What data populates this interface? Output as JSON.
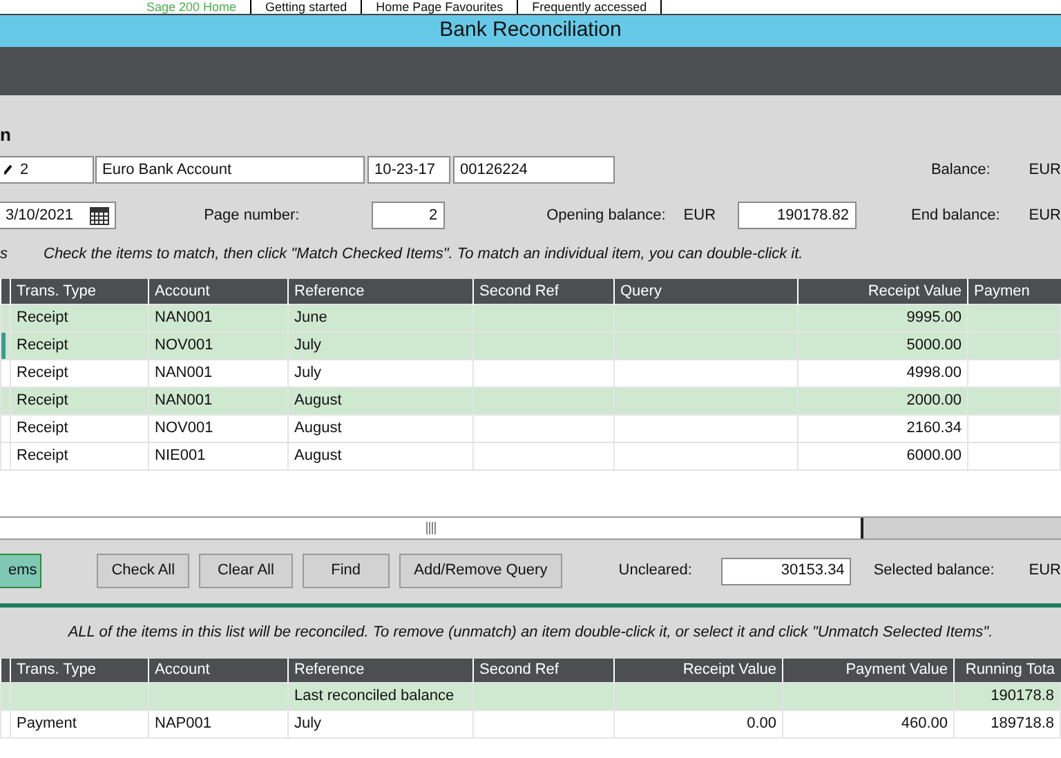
{
  "top_tabs": [
    {
      "label": "Sage 200 Home",
      "selected": true
    },
    {
      "label": "Getting started",
      "selected": false
    },
    {
      "label": "Home Page Favourites",
      "selected": false
    },
    {
      "label": "Frequently accessed",
      "selected": false
    }
  ],
  "window": {
    "title": "Bank Reconciliation"
  },
  "section_heading": "n",
  "bank": {
    "code": "2",
    "name": "Euro Bank Account",
    "sort_code": "10-23-17",
    "account_number": "00126224",
    "balance_label": "Balance:",
    "balance_currency": "EUR"
  },
  "statement": {
    "date": "3/10/2021",
    "page_label": "Page number:",
    "page": "2",
    "opening_label": "Opening balance:",
    "opening_currency": "EUR",
    "opening_balance": "190178.82",
    "end_label": "End balance:",
    "end_currency": "EUR"
  },
  "instruction_label": "s",
  "instruction": "Check the items to match, then click \"Match Checked Items\". To match an individual item, you can double-click it.",
  "unmatched": {
    "columns": [
      {
        "label": "Trans. Type",
        "numeric": false
      },
      {
        "label": "Account",
        "numeric": false
      },
      {
        "label": "Reference",
        "numeric": false
      },
      {
        "label": "Second Ref",
        "numeric": false
      },
      {
        "label": "Query",
        "numeric": false
      },
      {
        "label": "Receipt Value",
        "numeric": true
      },
      {
        "label": "Paymen",
        "numeric": false
      }
    ],
    "rows": [
      {
        "cells": [
          "Receipt",
          "NAN001",
          "June",
          null,
          null,
          "9995.00",
          null
        ],
        "checked": true,
        "current": false
      },
      {
        "cells": [
          "Receipt",
          "NOV001",
          "July",
          null,
          null,
          "5000.00",
          null
        ],
        "checked": true,
        "current": true
      },
      {
        "cells": [
          "Receipt",
          "NAN001",
          "July",
          null,
          null,
          "4998.00",
          null
        ],
        "checked": false,
        "current": false
      },
      {
        "cells": [
          "Receipt",
          "NAN001",
          "August",
          null,
          null,
          "2000.00",
          null
        ],
        "checked": true,
        "current": false
      },
      {
        "cells": [
          "Receipt",
          "NOV001",
          "August",
          null,
          null,
          "2160.34",
          null
        ],
        "checked": false,
        "current": false
      },
      {
        "cells": [
          "Receipt",
          "NIE001",
          "August",
          null,
          null,
          "6000.00",
          null
        ],
        "checked": false,
        "current": false
      }
    ]
  },
  "buttons": [
    {
      "label": "ems",
      "kind": "primary"
    },
    {
      "label": "Check All",
      "kind": "secondary"
    },
    {
      "label": "Clear All",
      "kind": "secondary"
    },
    {
      "label": "Find",
      "kind": "secondary"
    },
    {
      "label": "Add/Remove Query",
      "kind": "secondary"
    }
  ],
  "uncleared_label": "Uncleared:",
  "uncleared": "30153.34",
  "selected_label": "Selected balance:",
  "selected_currency": "EUR",
  "matched_instruction": "ALL of the items in this list will be reconciled. To remove (unmatch) an item double-click it, or select it and click \"Unmatch Selected Items\".",
  "matched": {
    "columns": [
      {
        "label": "Trans. Type",
        "numeric": false
      },
      {
        "label": "Account",
        "numeric": false
      },
      {
        "label": "Reference",
        "numeric": false
      },
      {
        "label": "Second Ref",
        "numeric": false
      },
      {
        "label": "Receipt Value",
        "numeric": true
      },
      {
        "label": "Payment Value",
        "numeric": true
      },
      {
        "label": "Running Tota",
        "numeric": true
      }
    ],
    "rows": [
      {
        "cells": [
          null,
          null,
          "Last reconciled balance",
          null,
          null,
          null,
          "190178.8"
        ],
        "highlighted": true
      },
      {
        "cells": [
          "Payment",
          "NAP001",
          "July",
          null,
          "0.00",
          "460.00",
          "189718.8"
        ],
        "highlighted": false
      }
    ]
  }
}
